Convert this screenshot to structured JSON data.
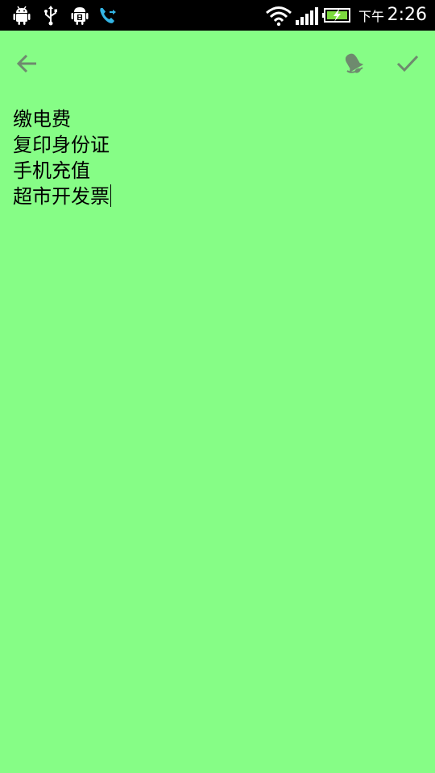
{
  "status_bar": {
    "icons_left": [
      "android-icon",
      "usb-icon",
      "debug-icon",
      "call-forward-icon"
    ],
    "icons_right": [
      "wifi-icon",
      "signal-icon",
      "battery-charging-icon"
    ],
    "am_pm": "下午",
    "time": "2:26",
    "colors": {
      "background": "#000000",
      "call_icon": "#33b5e5",
      "battery_fill": "#7cdb3e"
    }
  },
  "toolbar": {
    "back_icon": "arrow-left-icon",
    "reminder_icon": "bell-icon",
    "done_icon": "checkmark-icon",
    "icon_color": "#6e8a6e"
  },
  "note": {
    "background_color": "#86fd86",
    "lines": [
      "缴电费",
      "复印身份证",
      "手机充值",
      "超市开发票"
    ]
  }
}
